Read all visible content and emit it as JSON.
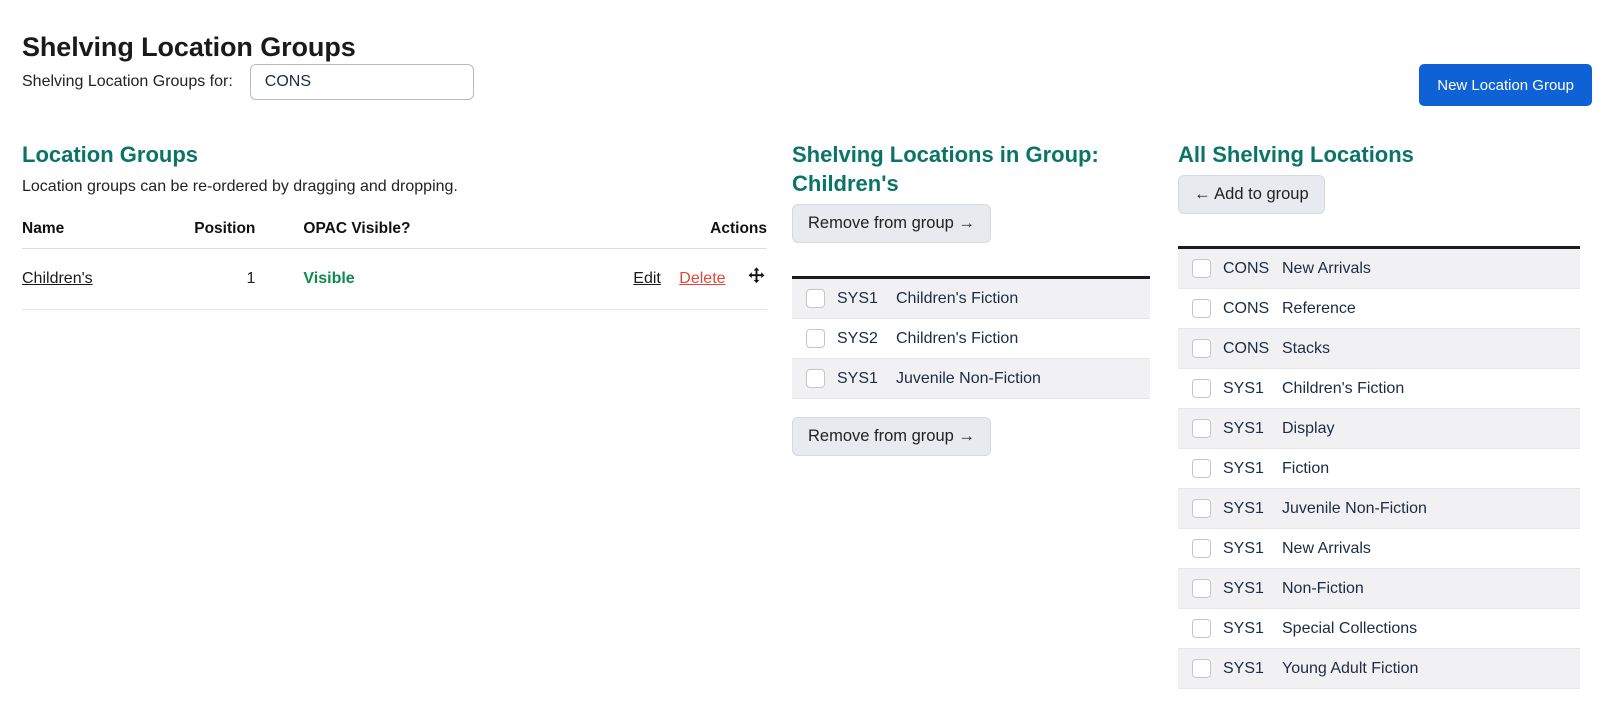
{
  "header": {
    "title": "Shelving Location Groups",
    "selector_label": "Shelving Location Groups for:",
    "selector_value": "CONS",
    "new_group_button": "New Location Group"
  },
  "location_groups": {
    "heading": "Location Groups",
    "description": "Location groups can be re-ordered by dragging and dropping.",
    "columns": {
      "name": "Name",
      "position": "Position",
      "opac_visible": "OPAC Visible?",
      "actions": "Actions"
    },
    "rows": [
      {
        "name": "Children's",
        "position": "1",
        "opac_visible": "Visible",
        "edit": "Edit",
        "delete": "Delete"
      }
    ]
  },
  "group_locations": {
    "heading": "Shelving Locations in Group: Children's",
    "remove_button_top": "Remove from group →",
    "remove_button_bottom": "Remove from group →",
    "items": [
      {
        "code": "SYS1",
        "name": "Children's Fiction"
      },
      {
        "code": "SYS2",
        "name": "Children's Fiction"
      },
      {
        "code": "SYS1",
        "name": "Juvenile Non-Fiction"
      }
    ]
  },
  "all_locations": {
    "heading": "All Shelving Locations",
    "add_button": "← Add to group",
    "items": [
      {
        "code": "CONS",
        "name": "New Arrivals"
      },
      {
        "code": "CONS",
        "name": "Reference"
      },
      {
        "code": "CONS",
        "name": "Stacks"
      },
      {
        "code": "SYS1",
        "name": "Children's Fiction"
      },
      {
        "code": "SYS1",
        "name": "Display"
      },
      {
        "code": "SYS1",
        "name": "Fiction"
      },
      {
        "code": "SYS1",
        "name": "Juvenile Non-Fiction"
      },
      {
        "code": "SYS1",
        "name": "New Arrivals"
      },
      {
        "code": "SYS1",
        "name": "Non-Fiction"
      },
      {
        "code": "SYS1",
        "name": "Special Collections"
      },
      {
        "code": "SYS1",
        "name": "Young Adult Fiction"
      }
    ]
  },
  "colors": {
    "heading_teal": "#0b7468",
    "primary_blue": "#0f62d5",
    "visible_green": "#0e8a4f",
    "delete_red": "#e0473a"
  }
}
